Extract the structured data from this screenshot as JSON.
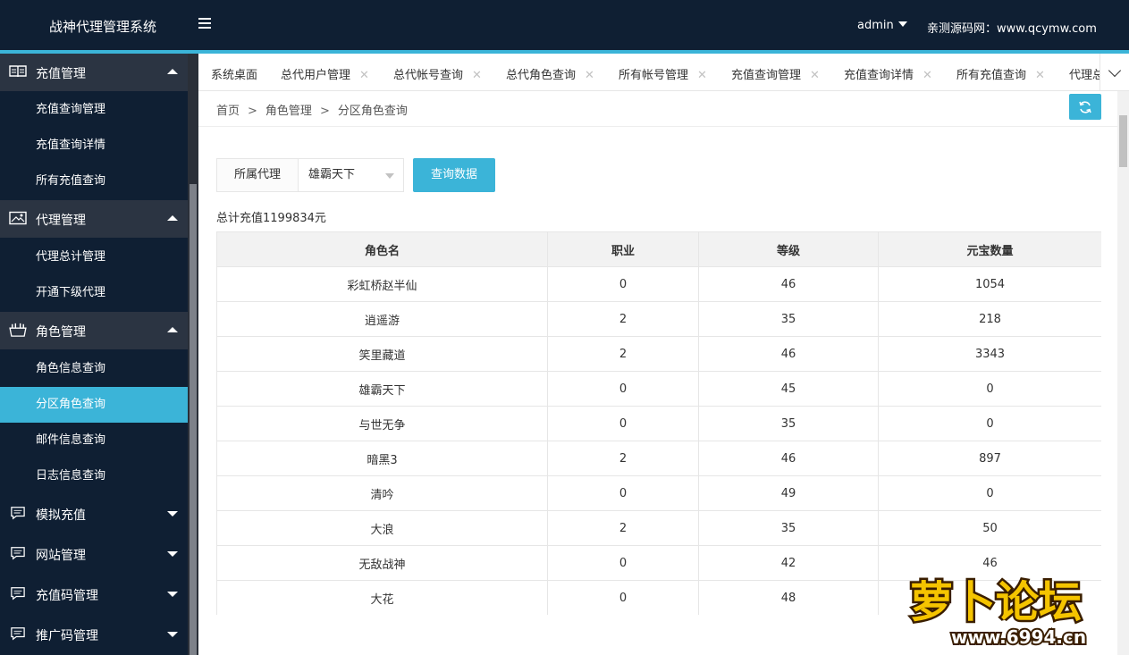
{
  "header": {
    "brand": "战神代理管理系统",
    "user": "admin",
    "site": "亲测源码网：www.qcymw.com"
  },
  "sidebar": {
    "groups": [
      {
        "label": "充值管理",
        "icon": "book-icon",
        "expanded": true,
        "items": [
          "充值查询管理",
          "充值查询详情",
          "所有充值查询"
        ]
      },
      {
        "label": "代理管理",
        "icon": "image-icon",
        "expanded": true,
        "items": [
          "代理总计管理",
          "开通下级代理"
        ]
      },
      {
        "label": "角色管理",
        "icon": "basket-icon",
        "expanded": true,
        "items": [
          "角色信息查询",
          "分区角色查询",
          "邮件信息查询",
          "日志信息查询"
        ],
        "active": "分区角色查询"
      },
      {
        "label": "模拟充值",
        "icon": "message-icon",
        "expanded": false
      },
      {
        "label": "网站管理",
        "icon": "message-icon",
        "expanded": false
      },
      {
        "label": "充值码管理",
        "icon": "message-icon",
        "expanded": false
      },
      {
        "label": "推广码管理",
        "icon": "message-icon",
        "expanded": false
      }
    ]
  },
  "tabs": [
    "系统桌面",
    "总代用户管理",
    "总代帐号查询",
    "总代角色查询",
    "所有帐号管理",
    "充值查询管理",
    "充值查询详情",
    "所有充值查询",
    "代理总"
  ],
  "breadcrumb": {
    "home": "首页",
    "level1": "角色管理",
    "level2": "分区角色查询",
    "sep": ">"
  },
  "filter": {
    "label": "所属代理",
    "selected": "雄霸天下",
    "button": "查询数据"
  },
  "total": "总计充值1199834元",
  "table": {
    "headers": [
      "角色名",
      "职业",
      "等级",
      "元宝数量"
    ],
    "rows": [
      [
        "彩虹桥赵半仙",
        "0",
        "46",
        "1054"
      ],
      [
        "逍遥游",
        "2",
        "35",
        "218"
      ],
      [
        "笑里藏道",
        "2",
        "46",
        "3343"
      ],
      [
        "雄霸天下",
        "0",
        "45",
        "0"
      ],
      [
        "与世无争",
        "0",
        "35",
        "0"
      ],
      [
        "暗黑3",
        "2",
        "46",
        "897"
      ],
      [
        "清吟",
        "0",
        "49",
        "0"
      ],
      [
        "大浪",
        "2",
        "35",
        "50"
      ],
      [
        "无敌战神",
        "0",
        "42",
        "46"
      ],
      [
        "大花",
        "0",
        "48",
        ""
      ]
    ]
  },
  "watermark": {
    "text": "萝卜论坛",
    "url": "www.6994.cn"
  },
  "colors": {
    "dark": "#0f1f33",
    "accent": "#3bb4d8",
    "group_bg": "#2b3442"
  }
}
